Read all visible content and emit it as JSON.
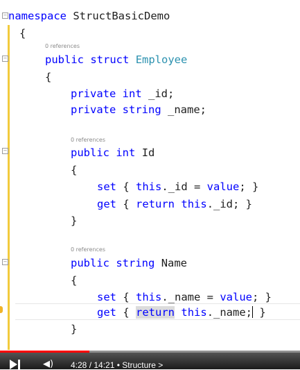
{
  "code": {
    "namespace_kw": "namespace",
    "namespace_name": "StructBasicDemo",
    "references_label": "0 references",
    "lines": {
      "open_brace": "{",
      "close_brace": "}",
      "public": "public",
      "struct": "struct",
      "employee": "Employee",
      "private": "private",
      "int": "int",
      "string": "string",
      "id_field": "_id;",
      "name_field": "_name;",
      "id_prop": "Id",
      "name_prop": "Name",
      "set": "set",
      "get": "get",
      "return": "return",
      "this": "this",
      "value": "value",
      "set_id_tail": "._id = ",
      "get_id_tail": "._id; }",
      "set_name_tail": "._name = ",
      "get_name_tail": "._name;",
      "brace_open_sp": "{ ",
      "semi_close": "; }",
      "close_sp": " }"
    }
  },
  "player": {
    "progress_fraction": 0.299,
    "time_text": "4:28 / 14:21",
    "separator": " • ",
    "chapter": "Structure",
    "chapter_chevron": ">",
    "colors": {
      "progress": "#ff0000"
    }
  }
}
